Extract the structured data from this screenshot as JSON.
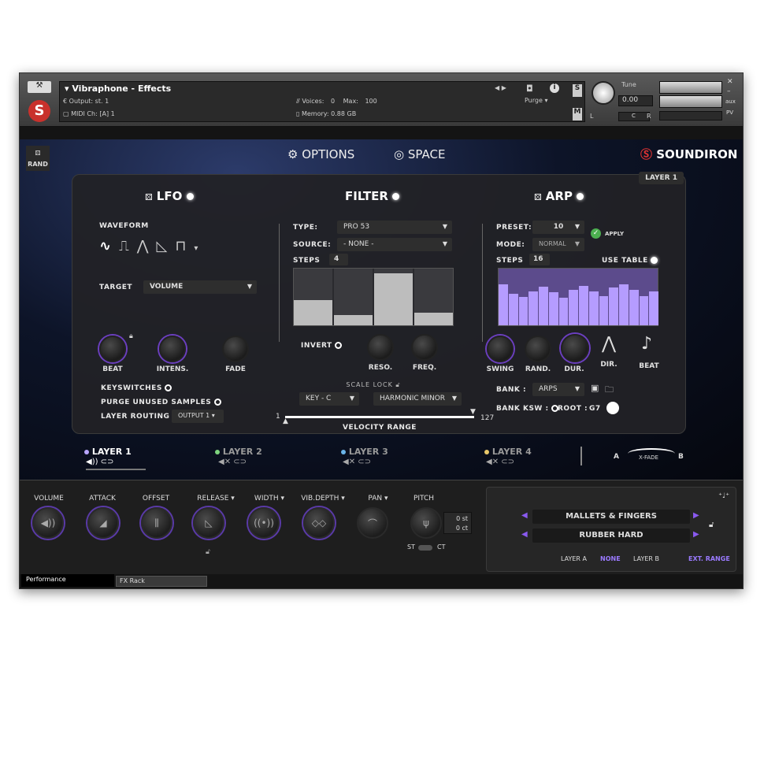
{
  "header": {
    "instrument": "Vibraphone - Effects",
    "output_label": "Output:",
    "output_value": "st. 1",
    "voices_label": "Voices:",
    "voices_value": "0",
    "max_label": "Max:",
    "max_value": "100",
    "midi_label": "MIDI Ch:",
    "midi_value": "[A] 1",
    "memory_label": "Memory:",
    "memory_value": "0.88 GB",
    "purge": "Purge",
    "tune_label": "Tune",
    "tune_value": "0.00",
    "s": "S",
    "m": "M",
    "aux": "aux",
    "pv": "PV",
    "l": "L",
    "r": "R",
    "c": "C"
  },
  "nav": {
    "rand": "RAND",
    "options": "OPTIONS",
    "space": "SPACE",
    "brand": "SOUNDIRON",
    "layer_badge": "LAYER 1"
  },
  "lfo": {
    "title": "LFO",
    "waveform": "WAVEFORM",
    "target_label": "TARGET",
    "target_value": "VOLUME",
    "beat": "BEAT",
    "intens": "INTENS.",
    "fade": "FADE",
    "keyswitches": "KEYSWITCHES",
    "purge_unused": "PURGE UNUSED SAMPLES",
    "layer_routing": "LAYER ROUTING",
    "routing_value": "OUTPUT 1"
  },
  "filter": {
    "title": "FILTER",
    "type_label": "TYPE:",
    "type_value": "PRO 53",
    "source_label": "SOURCE:",
    "source_value": "- NONE -",
    "steps_label": "STEPS",
    "steps_value": "4",
    "step_values": [
      0.45,
      0.18,
      0.92,
      0.22
    ],
    "invert": "INVERT",
    "reso": "RESO.",
    "freq": "FREQ.",
    "scale_lock": "SCALE LOCK",
    "key": "KEY - C",
    "scale": "HARMONIC MINOR",
    "vel_min": "1",
    "vel_max": "127",
    "vel_label": "VELOCITY RANGE"
  },
  "arp": {
    "title": "ARP",
    "preset_label": "PRESET:",
    "preset_value": "10",
    "apply": "APPLY",
    "mode_label": "MODE:",
    "mode_value": "NORMAL",
    "steps_label": "STEPS",
    "steps_value": "16",
    "use_table": "USE TABLE",
    "table_values": [
      0.72,
      0.55,
      0.5,
      0.6,
      0.68,
      0.58,
      0.48,
      0.62,
      0.7,
      0.6,
      0.52,
      0.66,
      0.72,
      0.62,
      0.52,
      0.6
    ],
    "swing": "SWING",
    "rand": "RAND.",
    "dur": "DUR.",
    "dir": "DIR.",
    "beat": "BEAT",
    "bank_label": "BANK :",
    "bank_value": "ARPS",
    "bank_ksw": "BANK KSW :",
    "root_label": "ROOT :",
    "root_value": "G7"
  },
  "layers": [
    {
      "name": "LAYER 1",
      "color": "#b9a6ff"
    },
    {
      "name": "LAYER 2",
      "color": "#7ed47e"
    },
    {
      "name": "LAYER 3",
      "color": "#6ab4e8"
    },
    {
      "name": "LAYER 4",
      "color": "#e8c86a"
    }
  ],
  "xfade": {
    "a": "A",
    "b": "B",
    "label": "X-FADE"
  },
  "perf": {
    "volume": "VOLUME",
    "attack": "ATTACK",
    "offset": "OFFSET",
    "release": "RELEASE",
    "width": "WIDTH",
    "vib": "VIB.DEPTH",
    "pan": "PAN",
    "pitch": "PITCH",
    "st_val": "0 st",
    "ct_val": "0 ct",
    "st": "ST",
    "ct": "CT"
  },
  "preset": {
    "a": "MALLETS & FINGERS",
    "b": "RUBBER HARD",
    "layer_a": "LAYER A",
    "none": "NONE",
    "layer_b": "LAYER B",
    "ext": "EXT. RANGE"
  },
  "tabs": {
    "perf": "Performance",
    "fx": "FX Rack"
  }
}
